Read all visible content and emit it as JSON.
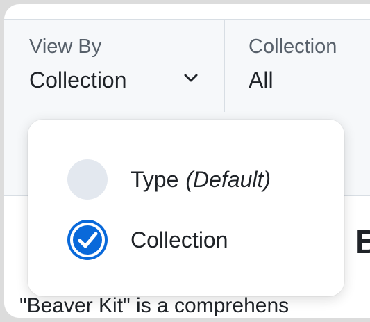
{
  "toolbar": {
    "view_by": {
      "label": "View By",
      "value": "Collection",
      "icon": "chevron-down-icon"
    },
    "collection": {
      "label": "Collection",
      "value": "All"
    }
  },
  "dropdown": {
    "options": [
      {
        "label": "Type",
        "suffix": "(Default)",
        "selected": false
      },
      {
        "label": "Collection",
        "suffix": "",
        "selected": true
      }
    ]
  },
  "content": {
    "heading_fragment": "B",
    "description": "\"Beaver Kit\" is a comprehens"
  },
  "colors": {
    "accent": "#0969da",
    "radio_unselected": "#e3e8ef",
    "toolbar_bg": "#f6f8fa",
    "border": "#d8dee4"
  }
}
